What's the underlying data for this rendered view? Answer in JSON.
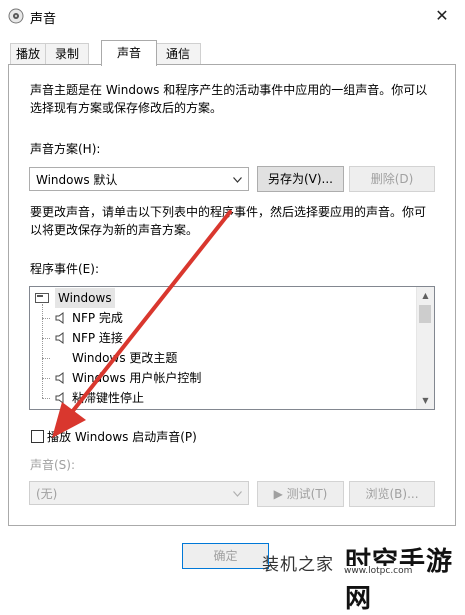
{
  "window": {
    "title": "声音",
    "close_glyph": "✕"
  },
  "tabs": [
    {
      "label": "播放"
    },
    {
      "label": "录制"
    },
    {
      "label": "声音",
      "active": true
    },
    {
      "label": "通信"
    }
  ],
  "intro_line1": "声音主题是在 Windows 和程序产生的活动事件中应用的一组声音。你可以",
  "intro_line2": "选择现有方案或保存修改后的方案。",
  "scheme": {
    "label": "声音方案(H):",
    "value": "Windows 默认",
    "save_as": "另存为(V)...",
    "delete": "删除(D)"
  },
  "change_line1": "要更改声音，请单击以下列表中的程序事件，然后选择要应用的声音。你可",
  "change_line2": "以将更改保存为新的声音方案。",
  "events": {
    "label": "程序事件(E):",
    "root": "Windows",
    "items": [
      {
        "label": "NFP 完成",
        "has_sound": true
      },
      {
        "label": "NFP 连接",
        "has_sound": true
      },
      {
        "label": "Windows 更改主题",
        "has_sound": false
      },
      {
        "label": "Windows 用户帐户控制",
        "has_sound": true
      },
      {
        "label": "粘滞键性停止",
        "has_sound": true
      }
    ]
  },
  "startup_sound": {
    "label": "播放 Windows 启动声音(P)",
    "checked": false
  },
  "sound": {
    "label": "声音(S):",
    "value": "(无)",
    "test": "▶ 测试(T)",
    "browse": "浏览(B)..."
  },
  "footer": {
    "ok": "确定"
  },
  "watermark": {
    "text1": "装机之家",
    "text2": "时空手游网",
    "url": "www.lotpc.com"
  },
  "colors": {
    "arrow": "#d9372e",
    "accent": "#0078d7"
  }
}
